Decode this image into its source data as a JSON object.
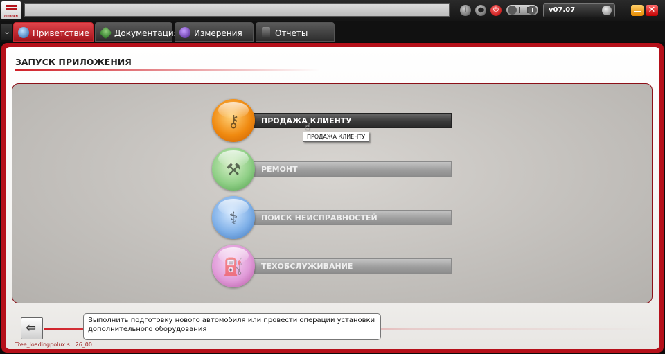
{
  "brand": {
    "logo_text": "CITROËN"
  },
  "topbar": {
    "address_value": "",
    "info_icon": "info-icon",
    "user_icon": "user-icon",
    "power_icon": "power-icon",
    "volume_minus": "−",
    "volume_plus": "+",
    "version": "v07.07",
    "close_glyph": "✕"
  },
  "tabs": [
    {
      "label": "Приветствие",
      "active": true,
      "icon": "welcome-icon"
    },
    {
      "label": "Документация",
      "active": false,
      "icon": "documentation-icon"
    },
    {
      "label": "Измерения",
      "active": false,
      "icon": "measurement-icon"
    },
    {
      "label": "Отчеты",
      "active": false,
      "icon": "reports-icon"
    }
  ],
  "page": {
    "title": "ЗАПУСК ПРИЛОЖЕНИЯ"
  },
  "menu": [
    {
      "label": "ПРОДАЖА КЛИЕНТУ",
      "icon": "key-icon",
      "color": "#f08a10",
      "active": true
    },
    {
      "label": "РЕМОНТ",
      "icon": "wrench-icon",
      "color": "#8fcf86",
      "active": false
    },
    {
      "label": "ПОИСК НЕИСПРАВНОСТЕЙ",
      "icon": "stethoscope-icon",
      "color": "#7fb0e8",
      "active": false
    },
    {
      "label": "ТЕХОБСЛУЖИВАНИЕ",
      "icon": "oil-can-icon",
      "color": "#e09ad8",
      "active": false
    }
  ],
  "tooltip": "ПРОДАЖА КЛИЕНТУ",
  "info_text": "Выполнить подготовку нового автомобиля или провести операции установки дополнительного оборудования",
  "status": "Tree_loadingpolux.s : 26_00",
  "colors": {
    "accent": "#b5101a",
    "tab_active": "#c8282f"
  }
}
